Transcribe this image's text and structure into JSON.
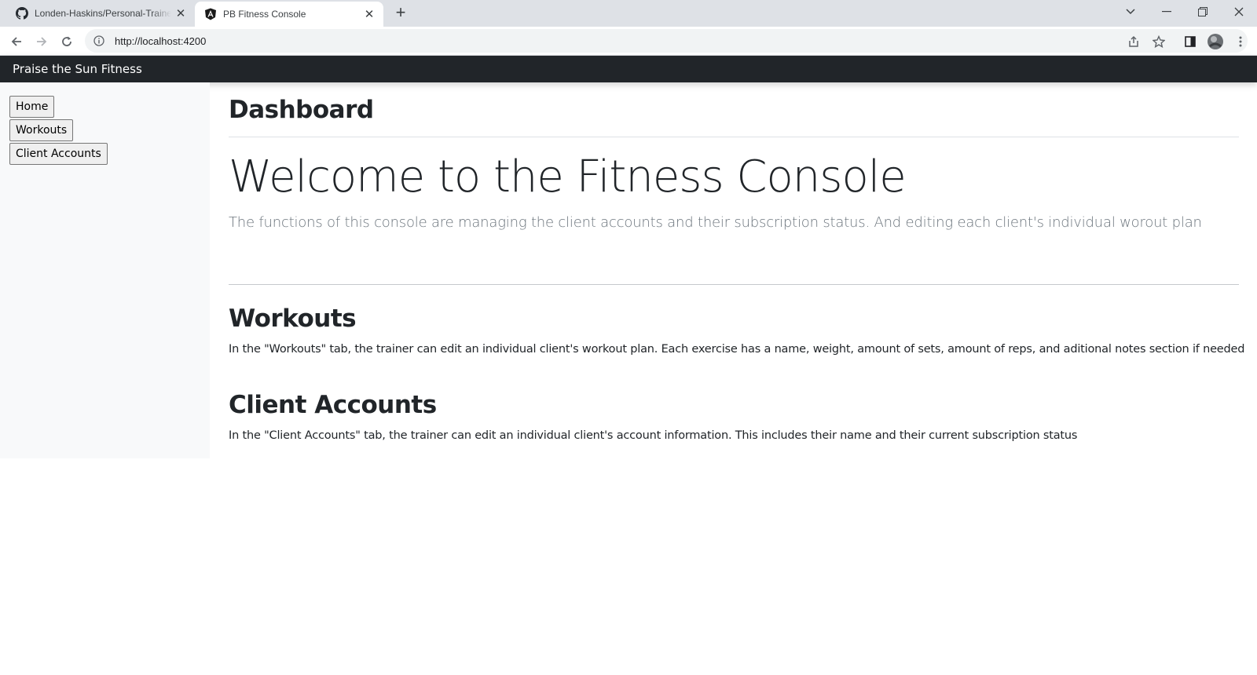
{
  "browser": {
    "tabs": [
      {
        "title": "Londen-Haskins/Personal-Trainer",
        "icon": "github-icon",
        "active": false
      },
      {
        "title": "PB Fitness Console",
        "icon": "angular-icon",
        "active": true
      }
    ],
    "url": "http://localhost:4200"
  },
  "navbar": {
    "brand": "Praise the Sun Fitness"
  },
  "sidebar": {
    "items": [
      {
        "label": "Home"
      },
      {
        "label": "Workouts"
      },
      {
        "label": "Client Accounts"
      }
    ]
  },
  "main": {
    "page_title": "Dashboard",
    "welcome_heading": "Welcome to the Fitness Console",
    "lead": "The functions of this console are managing the client accounts and their subscription status. And editing each client's individual worout plan",
    "sections": [
      {
        "heading": "Workouts",
        "text": "In the \"Workouts\" tab, the trainer can edit an individual client's workout plan. Each exercise has a name, weight, amount of sets, amount of reps, and aditional notes section if needed"
      },
      {
        "heading": "Client Accounts",
        "text": "In the \"Client Accounts\" tab, the trainer can edit an individual client's account information. This includes their name and their current subscription status"
      }
    ]
  },
  "colors": {
    "navbar_bg": "#212529",
    "sidebar_bg": "#f8f9fa",
    "lead_text": "#6c757d"
  }
}
